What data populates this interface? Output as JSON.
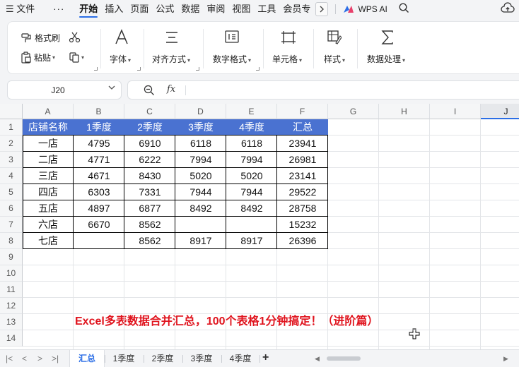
{
  "menu": {
    "hamburger": "☰",
    "file": "文件",
    "more": "···",
    "tabs": [
      "开始",
      "插入",
      "页面",
      "公式",
      "数据",
      "审阅",
      "视图",
      "工具",
      "会员专"
    ],
    "active_tab": "开始",
    "wps_ai": "WPS AI"
  },
  "ribbon": {
    "format_painter": "格式刷",
    "paste": "粘贴",
    "font": "字体",
    "alignment": "对齐方式",
    "number_format": "数字格式",
    "cell": "单元格",
    "style": "样式",
    "data_processing": "数据处理"
  },
  "formula_bar": {
    "cell_ref": "J20",
    "fx": "fx",
    "content": ""
  },
  "grid": {
    "columns": [
      "A",
      "B",
      "C",
      "D",
      "E",
      "F",
      "G",
      "H",
      "I",
      "J"
    ],
    "selected_column": "J",
    "row_numbers": [
      "1",
      "2",
      "3",
      "4",
      "5",
      "6",
      "7",
      "8",
      "9",
      "10",
      "11",
      "12",
      "13",
      "14"
    ],
    "header": [
      "店铺名称",
      "1季度",
      "2季度",
      "3季度",
      "4季度",
      "汇总"
    ],
    "rows": [
      [
        "一店",
        "4795",
        "6910",
        "6118",
        "6118",
        "23941"
      ],
      [
        "二店",
        "4771",
        "6222",
        "7994",
        "7994",
        "26981"
      ],
      [
        "三店",
        "4671",
        "8430",
        "5020",
        "5020",
        "23141"
      ],
      [
        "四店",
        "6303",
        "7331",
        "7944",
        "7944",
        "29522"
      ],
      [
        "五店",
        "4897",
        "6877",
        "8492",
        "8492",
        "28758"
      ],
      [
        "六店",
        "6670",
        "8562",
        "",
        "",
        "15232"
      ],
      [
        "七店",
        "",
        "8562",
        "8917",
        "8917",
        "26396"
      ]
    ],
    "header_color": "#4a72d1",
    "banner": "Excel多表数据合并汇总，100个表格1分钟搞定！（进阶篇）",
    "banner_color": "#e0141e"
  },
  "sheets": {
    "tabs": [
      "汇总",
      "1季度",
      "2季度",
      "3季度",
      "4季度"
    ],
    "active": "汇总",
    "add": "+"
  },
  "colors": {
    "accent": "#2b6ee6"
  }
}
